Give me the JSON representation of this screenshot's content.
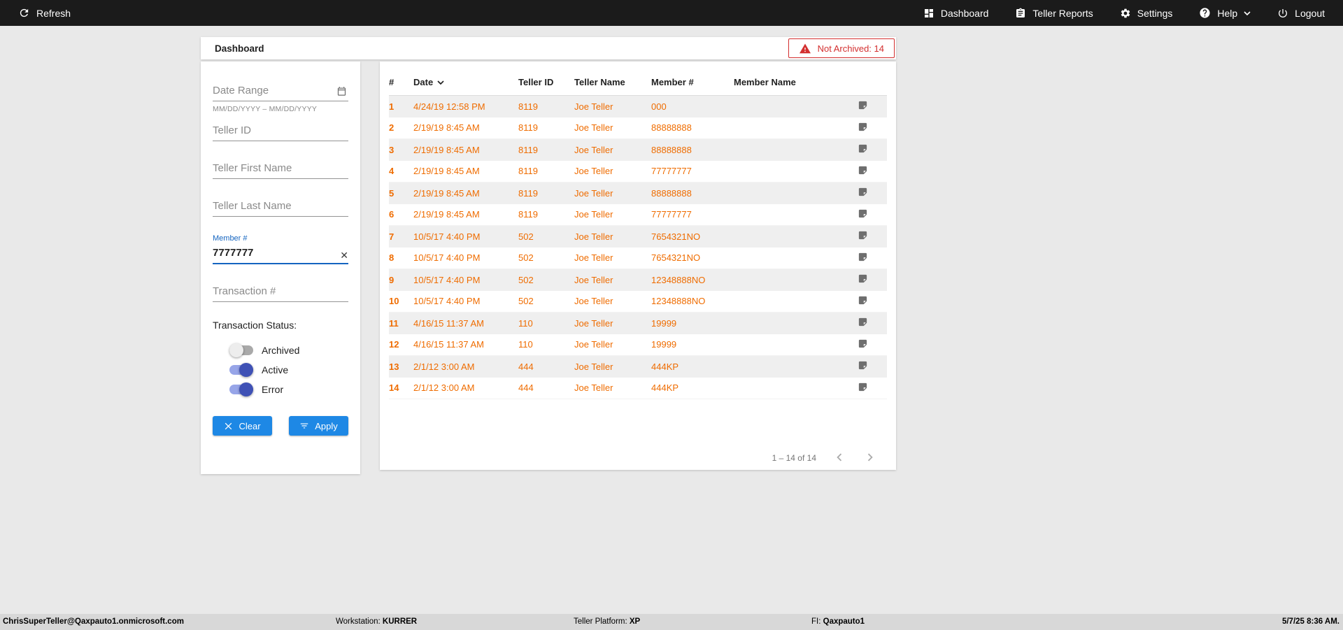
{
  "colors": {
    "accent_blue": "#1e88e5",
    "row_orange": "#ef6c00",
    "alert_red": "#d32f2f",
    "toggle_blue": "#3f51b5"
  },
  "topbar": {
    "refresh_label": "Refresh",
    "nav": [
      {
        "label": "Dashboard",
        "icon": "dashboard-icon"
      },
      {
        "label": "Teller Reports",
        "icon": "teller-reports-icon"
      },
      {
        "label": "Settings",
        "icon": "settings-icon"
      },
      {
        "label": "Help",
        "icon": "help-icon"
      },
      {
        "label": "Logout",
        "icon": "logout-icon"
      }
    ]
  },
  "header": {
    "title": "Dashboard",
    "not_archived_label": "Not Archived: 14"
  },
  "filters": {
    "date_range": {
      "placeholder": "Date Range",
      "helper": "MM/DD/YYYY – MM/DD/YYYY"
    },
    "teller_id": {
      "placeholder": "Teller ID"
    },
    "teller_first_name": {
      "placeholder": "Teller First Name"
    },
    "teller_last_name": {
      "placeholder": "Teller Last Name"
    },
    "member_number": {
      "label": "Member #",
      "value": "7777777"
    },
    "transaction_number": {
      "placeholder": "Transaction #"
    },
    "transaction_status": {
      "label": "Transaction Status:",
      "toggles": [
        {
          "label": "Archived",
          "on": false
        },
        {
          "label": "Active",
          "on": true
        },
        {
          "label": "Error",
          "on": true
        }
      ]
    },
    "clear_label": "Clear",
    "apply_label": "Apply"
  },
  "table": {
    "columns": [
      "#",
      "Date",
      "Teller ID",
      "Teller Name",
      "Member #",
      "Member Name"
    ],
    "rows": [
      {
        "num": "1",
        "date": "4/24/19 12:58 PM",
        "teller_id": "8119",
        "teller_name": "Joe Teller",
        "member_number": "000",
        "member_name": ""
      },
      {
        "num": "2",
        "date": "2/19/19 8:45 AM",
        "teller_id": "8119",
        "teller_name": "Joe Teller",
        "member_number": "88888888",
        "member_name": ""
      },
      {
        "num": "3",
        "date": "2/19/19 8:45 AM",
        "teller_id": "8119",
        "teller_name": "Joe Teller",
        "member_number": "88888888",
        "member_name": ""
      },
      {
        "num": "4",
        "date": "2/19/19 8:45 AM",
        "teller_id": "8119",
        "teller_name": "Joe Teller",
        "member_number": "77777777",
        "member_name": ""
      },
      {
        "num": "5",
        "date": "2/19/19 8:45 AM",
        "teller_id": "8119",
        "teller_name": "Joe Teller",
        "member_number": "88888888",
        "member_name": ""
      },
      {
        "num": "6",
        "date": "2/19/19 8:45 AM",
        "teller_id": "8119",
        "teller_name": "Joe Teller",
        "member_number": "77777777",
        "member_name": ""
      },
      {
        "num": "7",
        "date": "10/5/17 4:40 PM",
        "teller_id": "502",
        "teller_name": "Joe Teller",
        "member_number": "7654321NO",
        "member_name": ""
      },
      {
        "num": "8",
        "date": "10/5/17 4:40 PM",
        "teller_id": "502",
        "teller_name": "Joe Teller",
        "member_number": "7654321NO",
        "member_name": ""
      },
      {
        "num": "9",
        "date": "10/5/17 4:40 PM",
        "teller_id": "502",
        "teller_name": "Joe Teller",
        "member_number": "12348888NO",
        "member_name": ""
      },
      {
        "num": "10",
        "date": "10/5/17 4:40 PM",
        "teller_id": "502",
        "teller_name": "Joe Teller",
        "member_number": "12348888NO",
        "member_name": ""
      },
      {
        "num": "11",
        "date": "4/16/15 11:37 AM",
        "teller_id": "110",
        "teller_name": "Joe Teller",
        "member_number": "19999",
        "member_name": ""
      },
      {
        "num": "12",
        "date": "4/16/15 11:37 AM",
        "teller_id": "110",
        "teller_name": "Joe Teller",
        "member_number": "19999",
        "member_name": ""
      },
      {
        "num": "13",
        "date": "2/1/12 3:00 AM",
        "teller_id": "444",
        "teller_name": "Joe Teller",
        "member_number": "444KP",
        "member_name": ""
      },
      {
        "num": "14",
        "date": "2/1/12 3:00 AM",
        "teller_id": "444",
        "teller_name": "Joe Teller",
        "member_number": "444KP",
        "member_name": ""
      }
    ],
    "pagination": {
      "range_label": "1 – 14 of 14"
    }
  },
  "statusbar": {
    "user": "ChrisSuperTeller@Qaxpauto1.onmicrosoft.com",
    "workstation_label": "Workstation:",
    "workstation_value": "KURRER",
    "platform_label": "Teller Platform:",
    "platform_value": "XP",
    "fi_label": "FI:",
    "fi_value": "Qaxpauto1",
    "datetime": "5/7/25 8:36 AM."
  }
}
